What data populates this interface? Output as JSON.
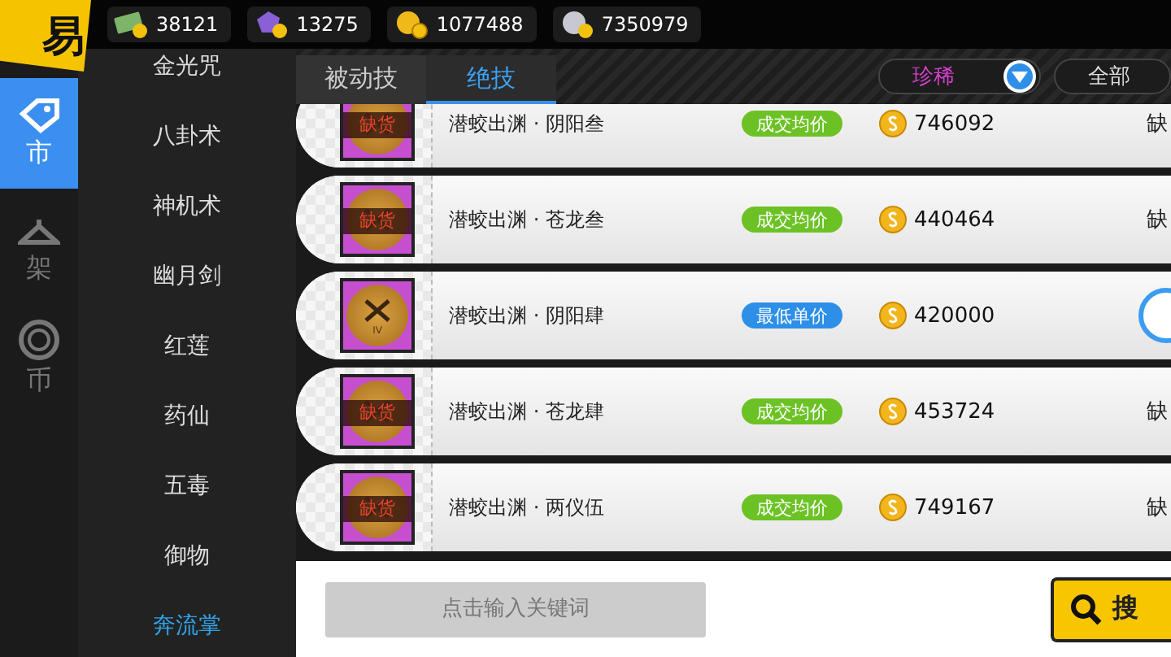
{
  "logo": {
    "text": "易"
  },
  "currencies": [
    {
      "kind": "cash",
      "amount": "38121"
    },
    {
      "kind": "gem",
      "amount": "13275"
    },
    {
      "kind": "gold",
      "amount": "1077488"
    },
    {
      "kind": "silver",
      "amount": "7350979"
    }
  ],
  "rail": [
    {
      "kind": "tag",
      "label": "市",
      "selected": true
    },
    {
      "kind": "hanger",
      "label": "架",
      "selected": false
    },
    {
      "kind": "coin",
      "label": "币",
      "selected": false
    }
  ],
  "categories": [
    {
      "label": "金光咒",
      "selected": false
    },
    {
      "label": "八卦术",
      "selected": false
    },
    {
      "label": "神机术",
      "selected": false
    },
    {
      "label": "幽月剑",
      "selected": false
    },
    {
      "label": "红莲",
      "selected": false
    },
    {
      "label": "药仙",
      "selected": false
    },
    {
      "label": "五毒",
      "selected": false
    },
    {
      "label": "御物",
      "selected": false
    },
    {
      "label": "奔流掌",
      "selected": true
    }
  ],
  "tabs": [
    {
      "label": "被动技",
      "selected": false
    },
    {
      "label": "绝技",
      "selected": true
    }
  ],
  "filters": [
    {
      "label": "珍稀",
      "kind": "dropdown",
      "color": "#d93fd0"
    },
    {
      "label": "全部",
      "kind": "plain",
      "color": "#dddddd"
    }
  ],
  "items": [
    {
      "name": "潜蛟出渊 · 阴阳叁",
      "icon": {
        "sold_out": true,
        "label": "缺货"
      },
      "tag": {
        "text": "成交均价",
        "color": "#6cc225"
      },
      "price": "746092",
      "right": {
        "kind": "status",
        "text": "缺"
      }
    },
    {
      "name": "潜蛟出渊 · 苍龙叁",
      "icon": {
        "sold_out": true,
        "label": "缺货"
      },
      "tag": {
        "text": "成交均价",
        "color": "#6cc225"
      },
      "price": "440464",
      "right": {
        "kind": "status",
        "text": "缺"
      }
    },
    {
      "name": "潜蛟出渊 · 阴阳肆",
      "icon": {
        "sold_out": false,
        "label": "IV"
      },
      "tag": {
        "text": "最低单价",
        "color": "#2d8fe8"
      },
      "price": "420000",
      "right": {
        "kind": "button"
      }
    },
    {
      "name": "潜蛟出渊 · 苍龙肆",
      "icon": {
        "sold_out": true,
        "label": "缺货"
      },
      "tag": {
        "text": "成交均价",
        "color": "#6cc225"
      },
      "price": "453724",
      "right": {
        "kind": "status",
        "text": "缺"
      }
    },
    {
      "name": "潜蛟出渊 · 两仪伍",
      "icon": {
        "sold_out": true,
        "label": "缺货"
      },
      "tag": {
        "text": "成交均价",
        "color": "#6cc225"
      },
      "price": "749167",
      "right": {
        "kind": "status",
        "text": "缺"
      }
    }
  ],
  "search": {
    "placeholder": "点击输入关键词",
    "button": "搜"
  }
}
